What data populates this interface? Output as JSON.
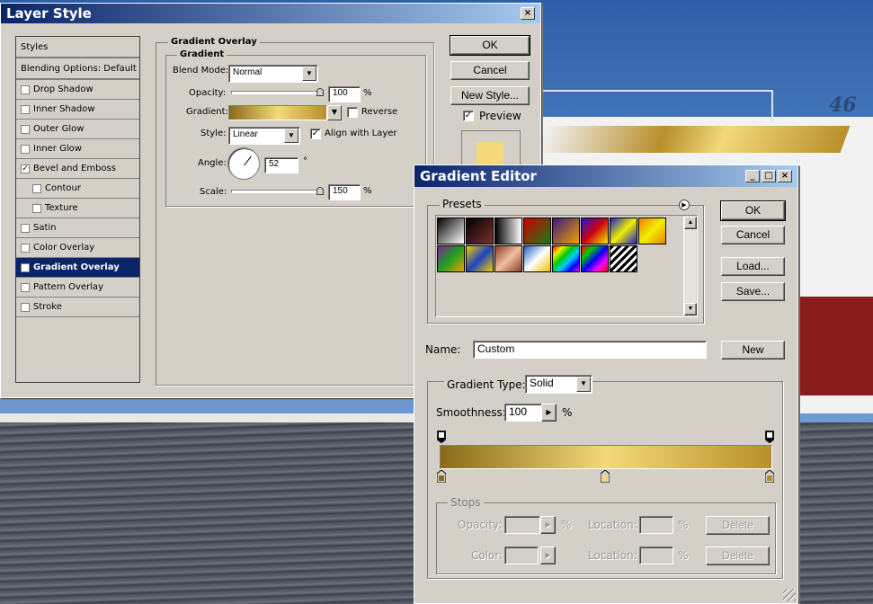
{
  "layer_style": {
    "title": "Layer Style",
    "close": "×",
    "sidebar": [
      {
        "label": "Styles",
        "checkbox": false,
        "checked": false,
        "header": true
      },
      {
        "label": "Blending Options: Default",
        "checkbox": false,
        "checked": false,
        "header": true
      },
      {
        "label": "Drop Shadow",
        "checkbox": true,
        "checked": false
      },
      {
        "label": "Inner Shadow",
        "checkbox": true,
        "checked": false
      },
      {
        "label": "Outer Glow",
        "checkbox": true,
        "checked": false
      },
      {
        "label": "Inner Glow",
        "checkbox": true,
        "checked": false
      },
      {
        "label": "Bevel and Emboss",
        "checkbox": true,
        "checked": true
      },
      {
        "label": "Contour",
        "checkbox": true,
        "checked": false,
        "indent": true
      },
      {
        "label": "Texture",
        "checkbox": true,
        "checked": false,
        "indent": true
      },
      {
        "label": "Satin",
        "checkbox": true,
        "checked": false
      },
      {
        "label": "Color Overlay",
        "checkbox": true,
        "checked": false
      },
      {
        "label": "Gradient Overlay",
        "checkbox": true,
        "checked": true,
        "selected": true
      },
      {
        "label": "Pattern Overlay",
        "checkbox": true,
        "checked": false
      },
      {
        "label": "Stroke",
        "checkbox": true,
        "checked": false
      }
    ],
    "panel_title": "Gradient Overlay",
    "group_title": "Gradient",
    "blend_mode_label": "Blend Mode:",
    "blend_mode_value": "Normal",
    "opacity_label": "Opacity:",
    "opacity_value": "100",
    "percent": "%",
    "gradient_label": "Gradient:",
    "reverse_label": "Reverse",
    "style_label": "Style:",
    "style_value": "Linear",
    "align_label": "Align with Layer",
    "angle_label": "Angle:",
    "angle_value": "52",
    "degree": "°",
    "scale_label": "Scale:",
    "scale_value": "150",
    "ok": "OK",
    "cancel": "Cancel",
    "new_style": "New Style...",
    "preview": "Preview"
  },
  "gradient_editor": {
    "title": "Gradient Editor",
    "minimize": "_",
    "maximize": "□",
    "close": "×",
    "presets_label": "Presets",
    "ok": "OK",
    "cancel": "Cancel",
    "load": "Load...",
    "save": "Save...",
    "name_label": "Name:",
    "name_value": "Custom",
    "new": "New",
    "gradient_type_label": "Gradient Type:",
    "gradient_type_value": "Solid",
    "smoothness_label": "Smoothness:",
    "smoothness_value": "100",
    "percent": "%",
    "stops_label": "Stops",
    "opacity_label": "Opacity:",
    "color_label": "Color:",
    "location_label": "Location:",
    "delete": "Delete",
    "presets": [
      "linear-gradient(135deg,#000,#fff)",
      "linear-gradient(135deg,#000,#7a3030)",
      "linear-gradient(90deg,#000,#fff)",
      "linear-gradient(135deg,#c00,#1a7a1a)",
      "linear-gradient(135deg,#3a1a80,#f0a000)",
      "linear-gradient(135deg,#1a1ad0,#d00010,#f0f000)",
      "linear-gradient(135deg,#1a1ad0,#f0f000,#1a1ad0)",
      "linear-gradient(135deg,#f08000,#f0f000,#f08000)",
      "linear-gradient(135deg,#8020a0,#20a020,#f0a000)",
      "linear-gradient(135deg,#f0d000,#2040c0,#f0d000)",
      "linear-gradient(135deg,#8a3a2a,#f0c0a0,#8a3a2a)",
      "linear-gradient(135deg,#1a60c0,#fff,#f0c000)",
      "linear-gradient(135deg,#f00,#f0f000,#0c0,#0cf,#00f,#f0f)",
      "linear-gradient(135deg,#f00,#0c0,#00f,#f0f,#f00)",
      "repeating-linear-gradient(135deg,#000 0,#000 3px,#fff 3px,#fff 6px)"
    ],
    "gradient_colors": [
      "#8a6a1a",
      "#f3d97a",
      "#b98f2c"
    ]
  }
}
